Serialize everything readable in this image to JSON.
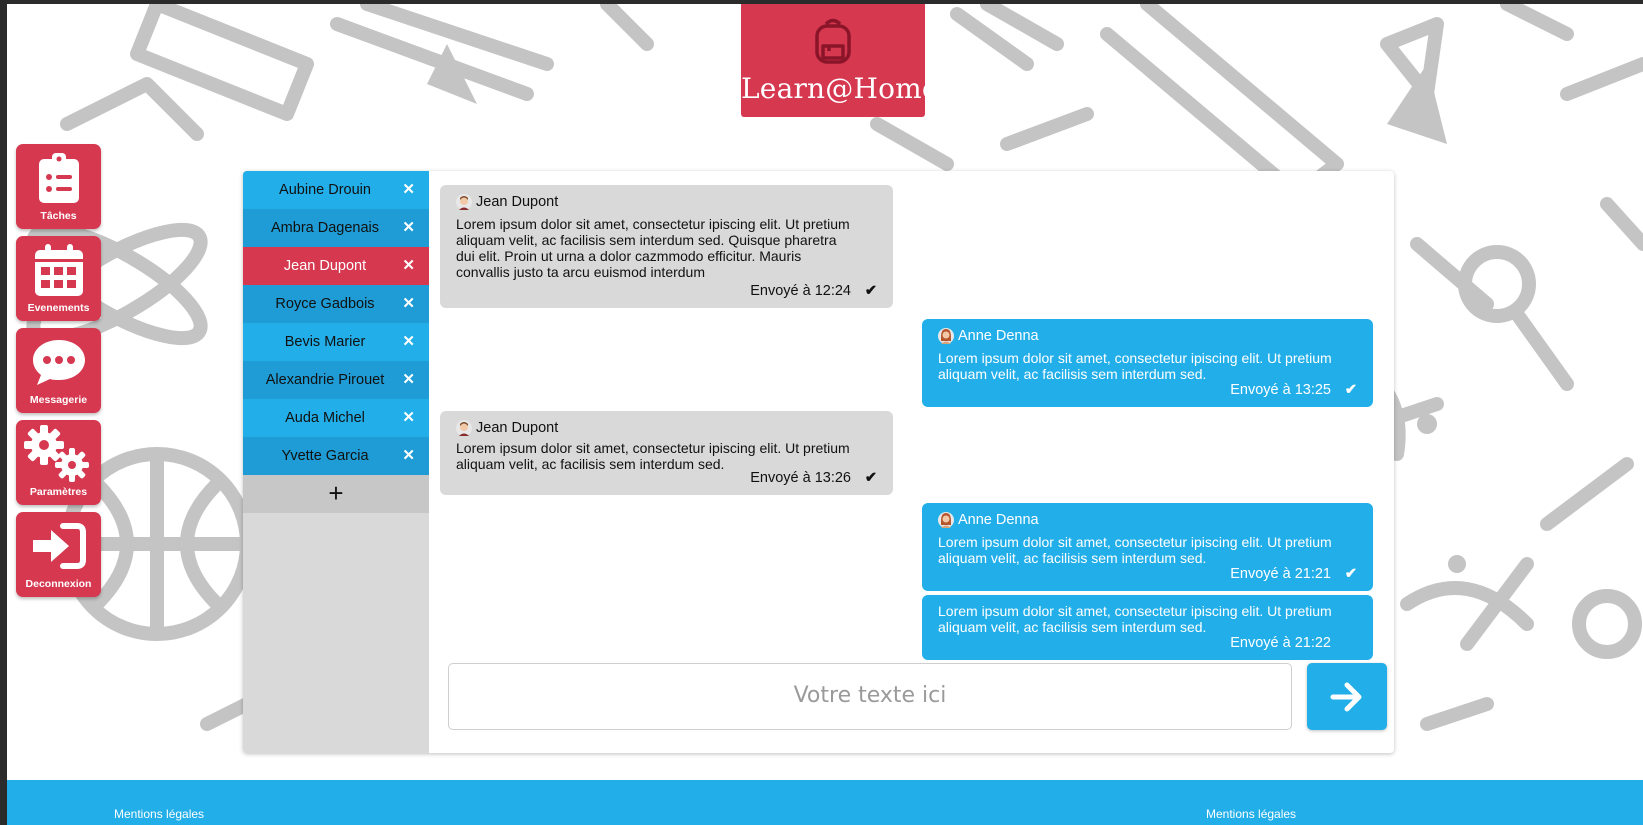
{
  "brand": {
    "name": "Learn@Home",
    "color": "#d63850",
    "icon": "backpack-icon"
  },
  "nav": [
    {
      "label": "Tâches",
      "icon": "clipboard-list-icon"
    },
    {
      "label": "Evenements",
      "icon": "calendar-icon"
    },
    {
      "label": "Messagerie",
      "icon": "chat-bubble-icon"
    },
    {
      "label": "Paramètres",
      "icon": "gears-icon"
    },
    {
      "label": "Deconnexion",
      "icon": "sign-in-icon"
    }
  ],
  "contacts": [
    {
      "name": "Aubine Drouin",
      "active": false
    },
    {
      "name": "Ambra Dagenais",
      "active": false
    },
    {
      "name": "Jean Dupont",
      "active": true
    },
    {
      "name": "Royce Gadbois",
      "active": false
    },
    {
      "name": "Bevis Marier",
      "active": false
    },
    {
      "name": "Alexandrie Pirouet",
      "active": false
    },
    {
      "name": "Auda Michel",
      "active": false
    },
    {
      "name": "Yvette Garcia",
      "active": false
    }
  ],
  "remove_icon": "close-icon",
  "add_contact": "+",
  "messages": [
    {
      "from": "Jean Dupont",
      "direction": "in",
      "avatar": "male-avatar-icon",
      "lines": [
        "Lorem ipsum dolor sit amet, consectetur ipiscing elit. Ut pretium",
        "aliquam velit, ac facilisis sem interdum sed. Quisque pharetra",
        "dui elit. Proin ut urna a dolor cazmmodo efficitur. Mauris",
        "convallis justo ta arcu euismod interdum"
      ],
      "time": "Envoyé à 12:24",
      "read": true
    },
    {
      "from": "Anne Denna",
      "direction": "out",
      "avatar": "female-avatar-icon",
      "lines": [
        "Lorem ipsum dolor sit amet, consectetur ipiscing elit. Ut pretium",
        "aliquam velit, ac facilisis sem interdum sed."
      ],
      "time": "Envoyé à 13:25",
      "read": true
    },
    {
      "from": "Jean Dupont",
      "direction": "in",
      "avatar": "male-avatar-icon",
      "lines": [
        "Lorem ipsum dolor sit amet, consectetur ipiscing elit. Ut pretium",
        "aliquam velit, ac facilisis sem interdum sed."
      ],
      "time": "Envoyé à 13:26",
      "read": true
    },
    {
      "from": "Anne Denna",
      "direction": "out",
      "avatar": "female-avatar-icon",
      "lines": [
        "Lorem ipsum dolor sit amet, consectetur ipiscing elit. Ut pretium",
        "aliquam velit, ac facilisis sem interdum sed."
      ],
      "time": "Envoyé à 21:21",
      "read": true
    },
    {
      "from": "",
      "direction": "out",
      "avatar": "",
      "lines": [
        "Lorem ipsum dolor sit amet, consectetur ipiscing elit. Ut pretium",
        "aliquam velit, ac facilisis sem interdum sed."
      ],
      "time": "Envoyé à 21:22",
      "read": false
    }
  ],
  "composer": {
    "placeholder": "Votre texte ici"
  },
  "send_icon": "arrow-right-icon",
  "footer": {
    "left_link": "Mentions légales",
    "right_link": "Mentions légales"
  },
  "colors": {
    "accent_red": "#d63850",
    "accent_blue": "#22aee9",
    "bubble_gray": "#d9d9d9"
  }
}
